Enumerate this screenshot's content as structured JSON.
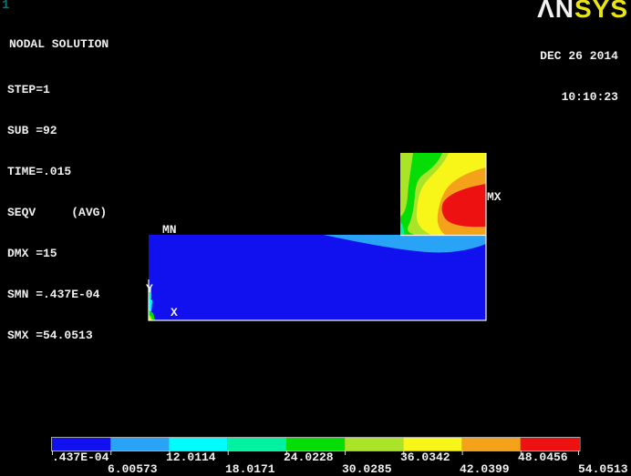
{
  "window": {
    "number": "1"
  },
  "header": {
    "logo_an": "ΛN",
    "logo_sys": "SYS",
    "date": "DEC 26 2014",
    "time": "10:10:23"
  },
  "annotation": {
    "title": "NODAL SOLUTION",
    "lines": [
      "STEP=1",
      "SUB =92",
      "TIME=.015",
      "SEQV     (AVG)",
      "DMX =15",
      "SMN =.437E-04",
      "SMX =54.0513"
    ]
  },
  "plot": {
    "mn": "MN",
    "mx": "MX",
    "axis_x": "X",
    "axis_y": "Y"
  },
  "legend": {
    "labels": [
      ".437E-04",
      "6.00573",
      "12.0114",
      "18.0171",
      "24.0228",
      "30.0285",
      "36.0342",
      "42.0399",
      "48.0456",
      "54.0513"
    ],
    "colors": [
      "#1111EF",
      "#29A3F6",
      "#00FDFD",
      "#00F2A0",
      "#06DD06",
      "#A9E428",
      "#F8F518",
      "#F5A21B",
      "#EE1111"
    ]
  }
}
